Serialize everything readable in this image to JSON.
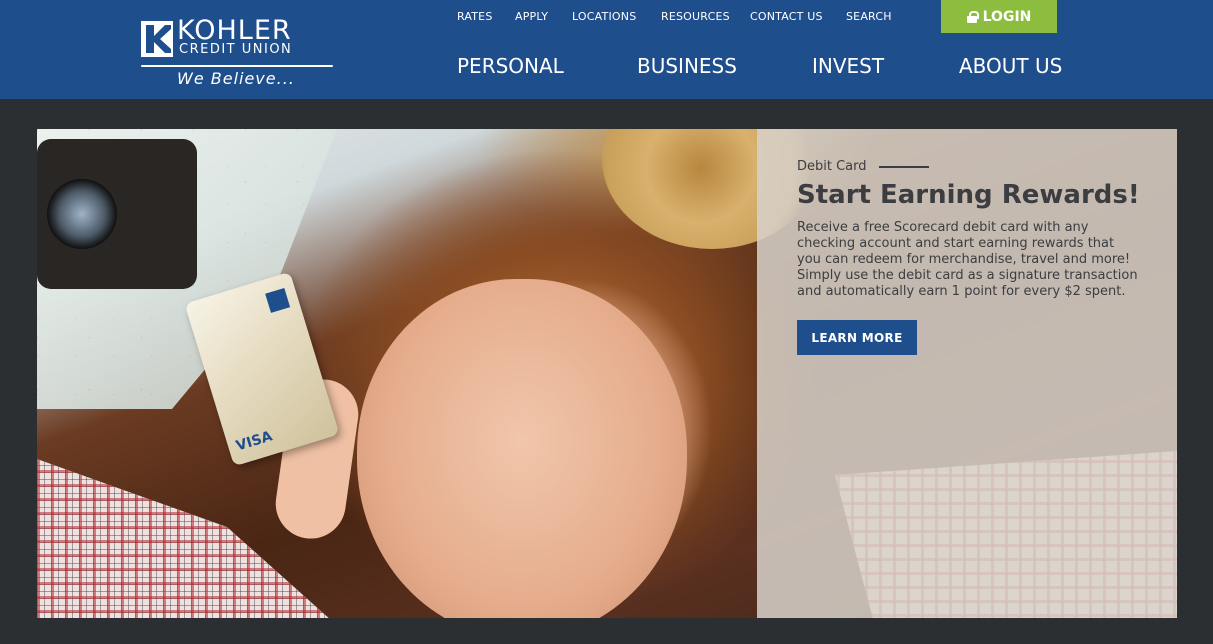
{
  "header": {
    "logo": {
      "name": "KOHLER",
      "sub": "CREDIT UNION",
      "tagline": "We Believe..."
    },
    "utility_nav": [
      "RATES",
      "APPLY",
      "LOCATIONS",
      "RESOURCES",
      "CONTACT US",
      "SEARCH"
    ],
    "login_label": "LOGIN",
    "main_nav": [
      "PERSONAL",
      "BUSINESS",
      "INVEST",
      "ABOUT US"
    ]
  },
  "hero": {
    "eyebrow": "Debit Card",
    "title": "Start Earning Rewards!",
    "body": "Receive a free Scorecard debit card with any checking account and start earning rewards that you can redeem for merchandise, travel and more! Simply use the debit card as a signature transaction and automatically earn 1 point for every $2 spent.",
    "cta_label": "LEARN MORE",
    "card_brand": "VISA"
  },
  "colors": {
    "header_bg": "#1f4e8c",
    "login_bg": "#8dbd3e",
    "page_bg": "#2b2f31",
    "cta_bg": "#1f4e8c"
  }
}
